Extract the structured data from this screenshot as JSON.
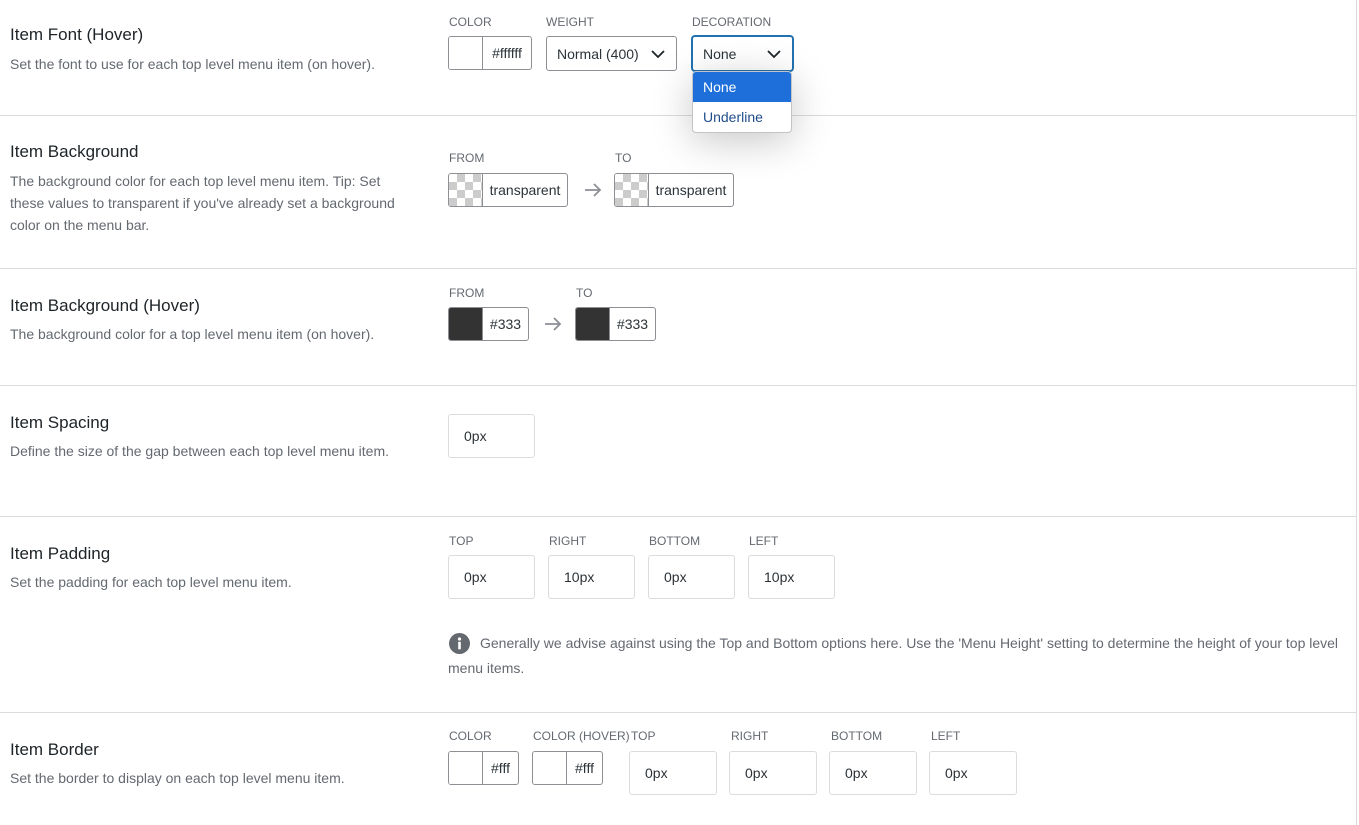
{
  "hover_font": {
    "title": "Item Font (Hover)",
    "description": "Set the font to use for each top level menu item (on hover).",
    "color_label": "COLOR",
    "color_value": "#ffffff",
    "weight_label": "WEIGHT",
    "weight_value": "Normal (400)",
    "decoration_label": "DECORATION",
    "decoration_value": "None",
    "decoration_options": [
      "None",
      "Underline"
    ],
    "swatch_color": "#ffffff"
  },
  "background": {
    "title": "Item Background",
    "description": "The background color for each top level menu item. Tip: Set these values to transparent if you've already set a background color on the menu bar.",
    "from_label": "FROM",
    "from_value": "transparent",
    "to_label": "TO",
    "to_value": "transparent"
  },
  "background_hover": {
    "title": "Item Background (Hover)",
    "description": "The background color for a top level menu item (on hover).",
    "from_label": "FROM",
    "from_value": "#333",
    "to_label": "TO",
    "to_value": "#333",
    "swatch_color": "#333333"
  },
  "spacing": {
    "title": "Item Spacing",
    "description": "Define the size of the gap between each top level menu item.",
    "value": "0px"
  },
  "padding": {
    "title": "Item Padding",
    "description": "Set the padding for each top level menu item.",
    "top_label": "TOP",
    "top_value": "0px",
    "right_label": "RIGHT",
    "right_value": "10px",
    "bottom_label": "BOTTOM",
    "bottom_value": "0px",
    "left_label": "LEFT",
    "left_value": "10px",
    "info": "Generally we advise against using the Top and Bottom options here. Use the 'Menu Height' setting to determine the height of your top level menu items."
  },
  "border": {
    "title": "Item Border",
    "description": "Set the border to display on each top level menu item.",
    "color_label": "COLOR",
    "color_value": "#fff",
    "color_hover_label": "COLOR (HOVER)",
    "color_hover_value": "#fff",
    "top_label": "TOP",
    "top_value": "0px",
    "right_label": "RIGHT",
    "right_value": "0px",
    "bottom_label": "BOTTOM",
    "bottom_value": "0px",
    "left_label": "LEFT",
    "left_value": "0px"
  },
  "colors": {
    "accent": "#2271b1",
    "selected_option": "#1e6fd9",
    "dark_swatch": "#333333"
  }
}
